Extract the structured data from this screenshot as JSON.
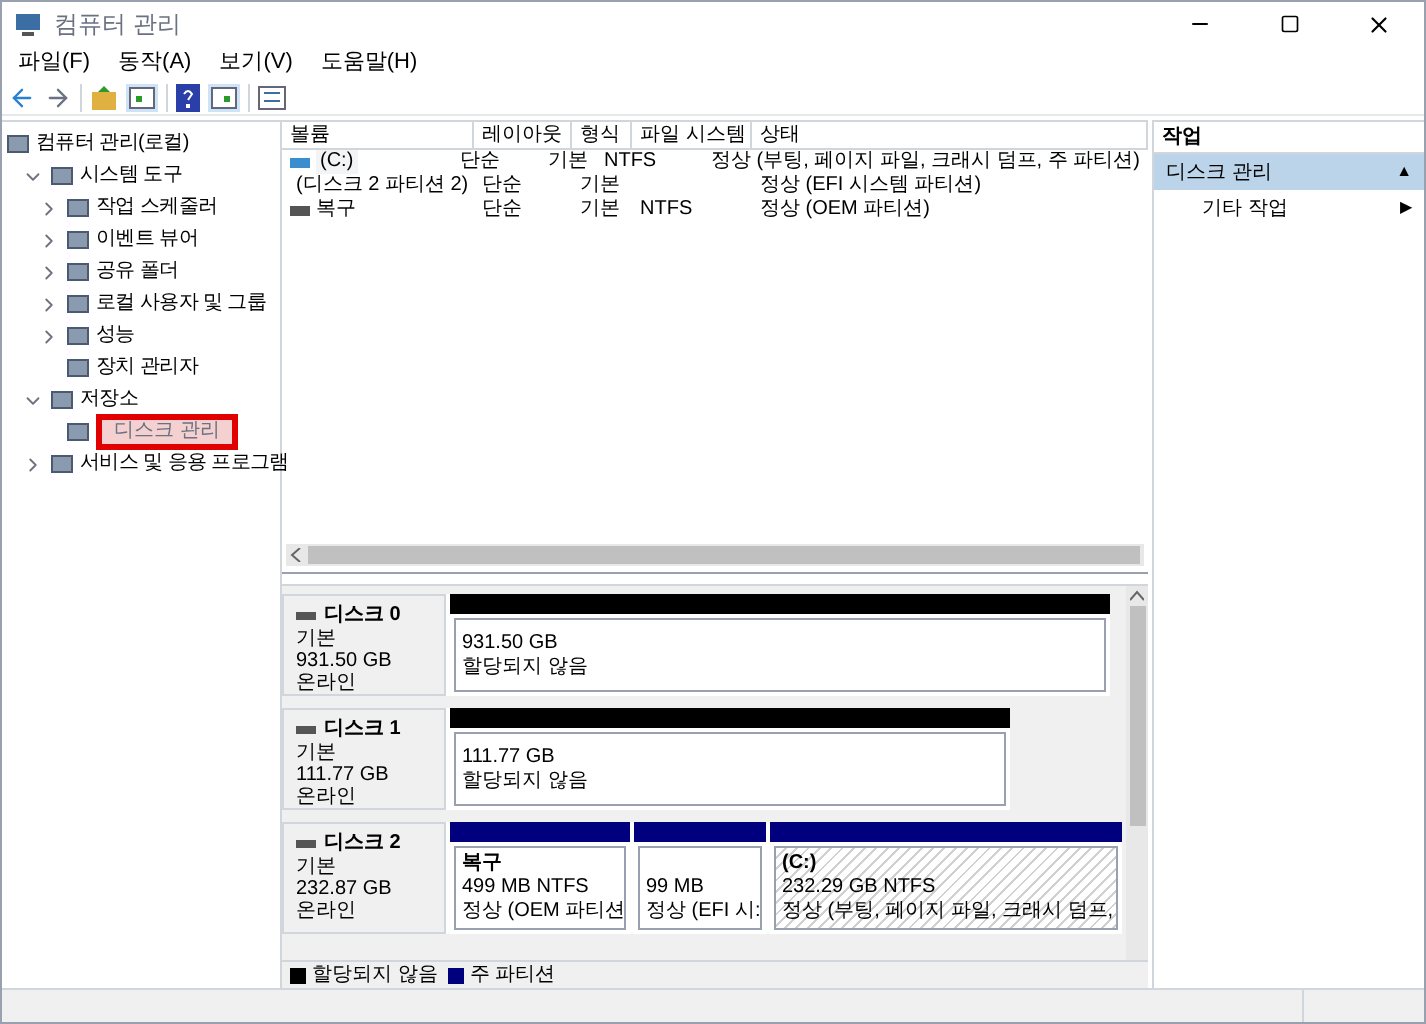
{
  "window": {
    "title": "컴퓨터 관리"
  },
  "menu": [
    "파일(F)",
    "동작(A)",
    "보기(V)",
    "도움말(H)"
  ],
  "tree": [
    {
      "label": "컴퓨터 관리(로컬)",
      "children": [
        {
          "label": "시스템 도구",
          "kind": "node",
          "expanded": true,
          "children": [
            {
              "label": "작업 스케줄러",
              "kind": "node",
              "expanded": false
            },
            {
              "label": "이벤트 뷰어",
              "kind": "node",
              "expanded": false
            },
            {
              "label": "공유 폴더",
              "kind": "node",
              "expanded": false
            },
            {
              "label": "로컬 사용자 및 그룹",
              "kind": "node",
              "expanded": false
            },
            {
              "label": "성능",
              "kind": "node",
              "expanded": false
            },
            {
              "label": "장치 관리자",
              "kind": "leaf"
            }
          ]
        },
        {
          "label": "저장소",
          "kind": "node",
          "expanded": true,
          "children": [
            {
              "label": "디스크 관리",
              "kind": "leaf",
              "highlighted": true
            }
          ]
        },
        {
          "label": "서비스 및 응용 프로그램",
          "kind": "node",
          "expanded": false
        }
      ]
    }
  ],
  "volumes": {
    "columns": [
      "볼륨",
      "레이아웃",
      "형식",
      "파일 시스템",
      "상태"
    ],
    "rows": [
      {
        "cells": [
          "(C:)",
          "단순",
          "기본",
          "NTFS",
          "정상 (부팅, 페이지 파일, 크래시 덤프, 주 파티션)"
        ],
        "selected": true
      },
      {
        "cells": [
          "(디스크 2 파티션 2)",
          "단순",
          "기본",
          "",
          "정상 (EFI 시스템 파티션)"
        ],
        "selected": false
      },
      {
        "cells": [
          "복구",
          "단순",
          "기본",
          "NTFS",
          "정상 (OEM 파티션)"
        ],
        "selected": false
      }
    ]
  },
  "disks": [
    {
      "name": "디스크 0",
      "type": "기본",
      "size": "931.50 GB",
      "status": "온라인",
      "partitions": [
        {
          "kind": "unallocated",
          "selected": false,
          "lines": [
            "931.50 GB",
            "할당되지 않음"
          ]
        }
      ]
    },
    {
      "name": "디스크 1",
      "type": "기본",
      "size": "111.77 GB",
      "status": "온라인",
      "partitions": [
        {
          "kind": "unallocated",
          "selected": false,
          "lines": [
            "111.77 GB",
            "할당되지 않음"
          ]
        }
      ]
    },
    {
      "name": "디스크 2",
      "type": "기본",
      "size": "232.87 GB",
      "status": "온라인",
      "partitions": [
        {
          "kind": "primary",
          "selected": false,
          "title": "복구",
          "lines": [
            "499 MB NTFS",
            "정상 (OEM 파티션"
          ]
        },
        {
          "kind": "primary",
          "selected": false,
          "lines": [
            "99 MB",
            "정상 (EFI 시:"
          ]
        },
        {
          "kind": "primary",
          "selected": true,
          "title": "(C:)",
          "lines": [
            "232.29 GB NTFS",
            "정상 (부팅, 페이지 파일, 크래시 덤프,"
          ]
        }
      ]
    }
  ],
  "legend": [
    {
      "label": "할당되지 않음",
      "color": "#000000"
    },
    {
      "label": "주 파티션",
      "color": "#00007f"
    }
  ],
  "actions": {
    "title": "작업",
    "sections": [
      {
        "label": "디스크 관리",
        "arrow": "▲",
        "kind": "header"
      },
      {
        "label": "기타 작업",
        "arrow": "▶",
        "kind": "item"
      }
    ]
  }
}
